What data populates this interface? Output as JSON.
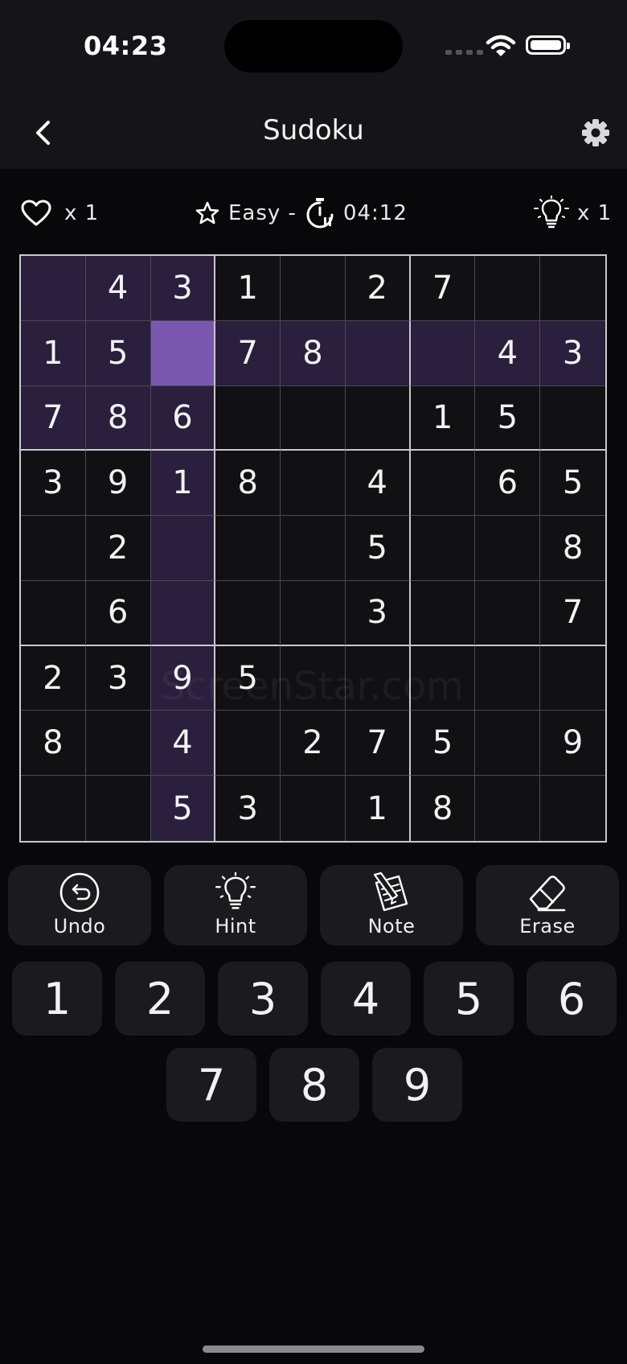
{
  "status_bar": {
    "time": "04:23"
  },
  "nav": {
    "title": "Sudoku"
  },
  "stats": {
    "lives": "x 1",
    "difficulty": "Easy -",
    "timer": "04:12",
    "hints": "x 1"
  },
  "board": {
    "rows": [
      [
        "",
        "4",
        "3",
        "1",
        "",
        "2",
        "7",
        "",
        ""
      ],
      [
        "1",
        "5",
        "",
        "7",
        "8",
        "",
        "",
        "4",
        "3"
      ],
      [
        "7",
        "8",
        "6",
        "",
        "",
        "",
        "1",
        "5",
        ""
      ],
      [
        "3",
        "9",
        "1",
        "8",
        "",
        "4",
        "",
        "6",
        "5"
      ],
      [
        "",
        "2",
        "",
        "",
        "",
        "5",
        "",
        "",
        "8"
      ],
      [
        "",
        "6",
        "",
        "",
        "",
        "3",
        "",
        "",
        "7"
      ],
      [
        "2",
        "3",
        "9",
        "5",
        "",
        "",
        "",
        "",
        ""
      ],
      [
        "8",
        "",
        "4",
        "",
        "2",
        "7",
        "5",
        "",
        "9"
      ],
      [
        "",
        "",
        "5",
        "3",
        "",
        "1",
        "8",
        "",
        ""
      ]
    ],
    "selected": {
      "row": 1,
      "col": 2
    },
    "highlight_color": "#2a1f3d",
    "selected_color": "#7a58b0"
  },
  "watermark": "ScreenStar.com",
  "tools": [
    {
      "label": "Undo",
      "icon": "undo-icon"
    },
    {
      "label": "Hint",
      "icon": "lightbulb-icon"
    },
    {
      "label": "Note",
      "icon": "note-icon"
    },
    {
      "label": "Erase",
      "icon": "eraser-icon"
    }
  ],
  "keypad": [
    "1",
    "2",
    "3",
    "4",
    "5",
    "6",
    "7",
    "8",
    "9"
  ]
}
